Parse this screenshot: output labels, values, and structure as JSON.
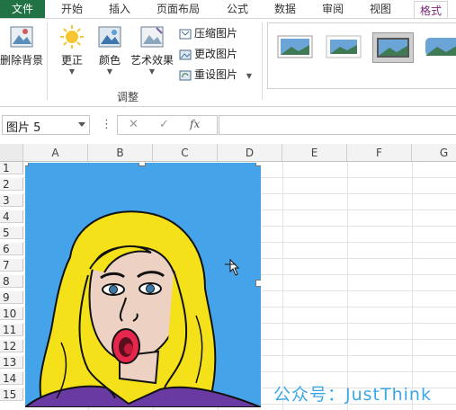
{
  "tabs": {
    "file": "文件",
    "items": [
      "开始",
      "插入",
      "页面布局",
      "公式",
      "数据",
      "审阅",
      "视图"
    ],
    "active": "格式"
  },
  "ribbon": {
    "remove_bg": "删除背景",
    "corrections": "更正",
    "color": "颜色",
    "artistic": "艺术效果",
    "compress": "压缩图片",
    "change": "更改图片",
    "reset": "重设图片",
    "group_label": "调整"
  },
  "formula_bar": {
    "name_box": "图片 5",
    "fx": "fx",
    "cancel": "✕",
    "enter": "✓",
    "colon": "⋮",
    "formula_value": ""
  },
  "grid": {
    "columns": [
      "A",
      "B",
      "C",
      "D",
      "E",
      "F",
      "G"
    ],
    "rows": [
      "1",
      "2",
      "3",
      "4",
      "5",
      "6",
      "7",
      "8",
      "9",
      "10",
      "11",
      "12",
      "13",
      "14",
      "15"
    ]
  },
  "watermark": "公众号：JustThink",
  "colors": {
    "file_tab": "#217346",
    "format_tab": "#7b2a7b",
    "picture_bg": "#45a3ea",
    "hair": "#f5e11a",
    "skin": "#edd2c4",
    "shirt": "#6a3aa3",
    "watermark": "#3ca7e6"
  }
}
